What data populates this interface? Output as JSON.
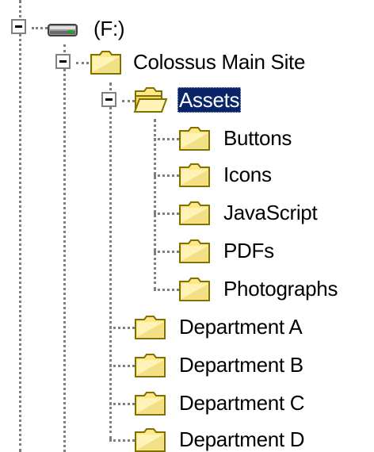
{
  "tree": {
    "drive": {
      "label": "(F:)",
      "icon": "drive-icon",
      "expanded": true
    },
    "site": {
      "label": "Colossus Main Site",
      "icon": "folder-icon",
      "expanded": true
    },
    "assets": {
      "label": "Assets",
      "icon": "folder-open-icon",
      "expanded": true,
      "selected": true
    },
    "asset_children": [
      {
        "label": "Buttons",
        "icon": "folder-icon"
      },
      {
        "label": "Icons",
        "icon": "folder-icon"
      },
      {
        "label": "JavaScript",
        "icon": "folder-icon"
      },
      {
        "label": "PDFs",
        "icon": "folder-icon"
      },
      {
        "label": "Photographs",
        "icon": "folder-icon"
      }
    ],
    "site_children": [
      {
        "label": "Department A",
        "icon": "folder-icon"
      },
      {
        "label": "Department B",
        "icon": "folder-icon"
      },
      {
        "label": "Department C",
        "icon": "folder-icon"
      },
      {
        "label": "Department D",
        "icon": "folder-icon"
      }
    ]
  },
  "colors": {
    "selection": "#0a246a",
    "folder": "#ffe88a",
    "folder_outline": "#807000",
    "connector": "#7f7f7f"
  }
}
